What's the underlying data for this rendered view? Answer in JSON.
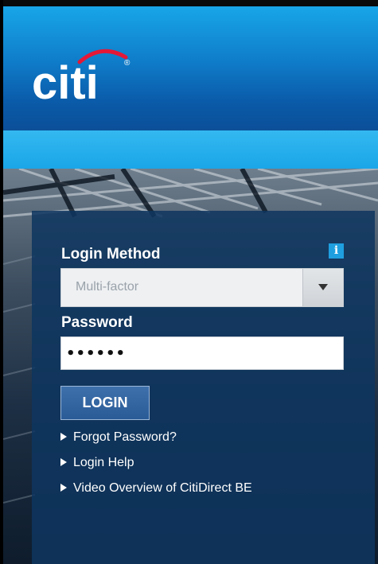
{
  "brand": {
    "name": "citi",
    "registered_mark": "®",
    "arc_color": "#e31837"
  },
  "form": {
    "info_button": "i",
    "login_method_label": "Login Method",
    "login_method_value": "Multi-factor",
    "password_label": "Password",
    "password_value": "••••••",
    "login_button": "LOGIN"
  },
  "links": [
    {
      "label": "Forgot Password?"
    },
    {
      "label": "Login Help"
    },
    {
      "label": "Video Overview of CitiDirect BE"
    }
  ],
  "colors": {
    "header_blue": "#0f7cc9",
    "band_blue": "#1aa6e8",
    "panel_blue": "#0e3660",
    "info_blue": "#1f9fe0"
  }
}
